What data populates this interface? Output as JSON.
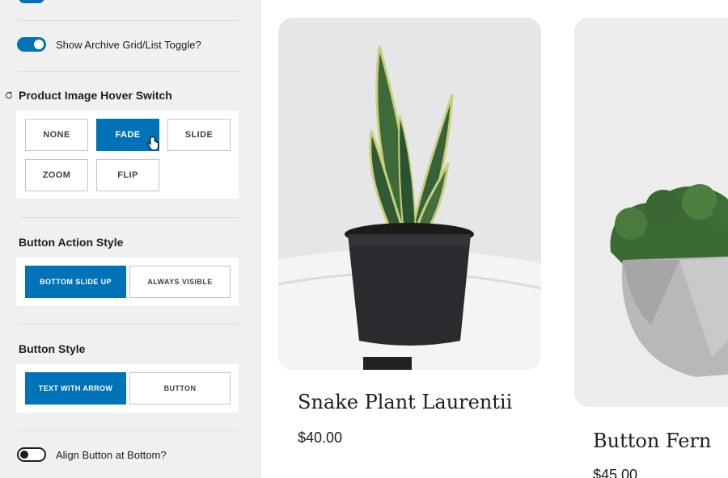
{
  "settings": {
    "archive_toggle_label": "Show Archive Grid/List Toggle?",
    "hover_switch": {
      "title": "Product Image Hover Switch",
      "options": [
        "NONE",
        "FADE",
        "SLIDE",
        "ZOOM",
        "FLIP"
      ],
      "selected": "FADE"
    },
    "button_action_style": {
      "title": "Button Action Style",
      "options": [
        "BOTTOM SLIDE UP",
        "ALWAYS VISIBLE"
      ],
      "selected": "BOTTOM SLIDE UP"
    },
    "button_style": {
      "title": "Button Style",
      "options": [
        "TEXT WITH ARROW",
        "BUTTON"
      ],
      "selected": "TEXT WITH ARROW"
    },
    "align_button_label": "Align Button at Bottom?"
  },
  "products": [
    {
      "name": "Snake Plant Laurentii",
      "price": "$40.00"
    },
    {
      "name": "Button Fern",
      "price": "$45.00"
    }
  ],
  "colors": {
    "accent": "#0072b8"
  }
}
